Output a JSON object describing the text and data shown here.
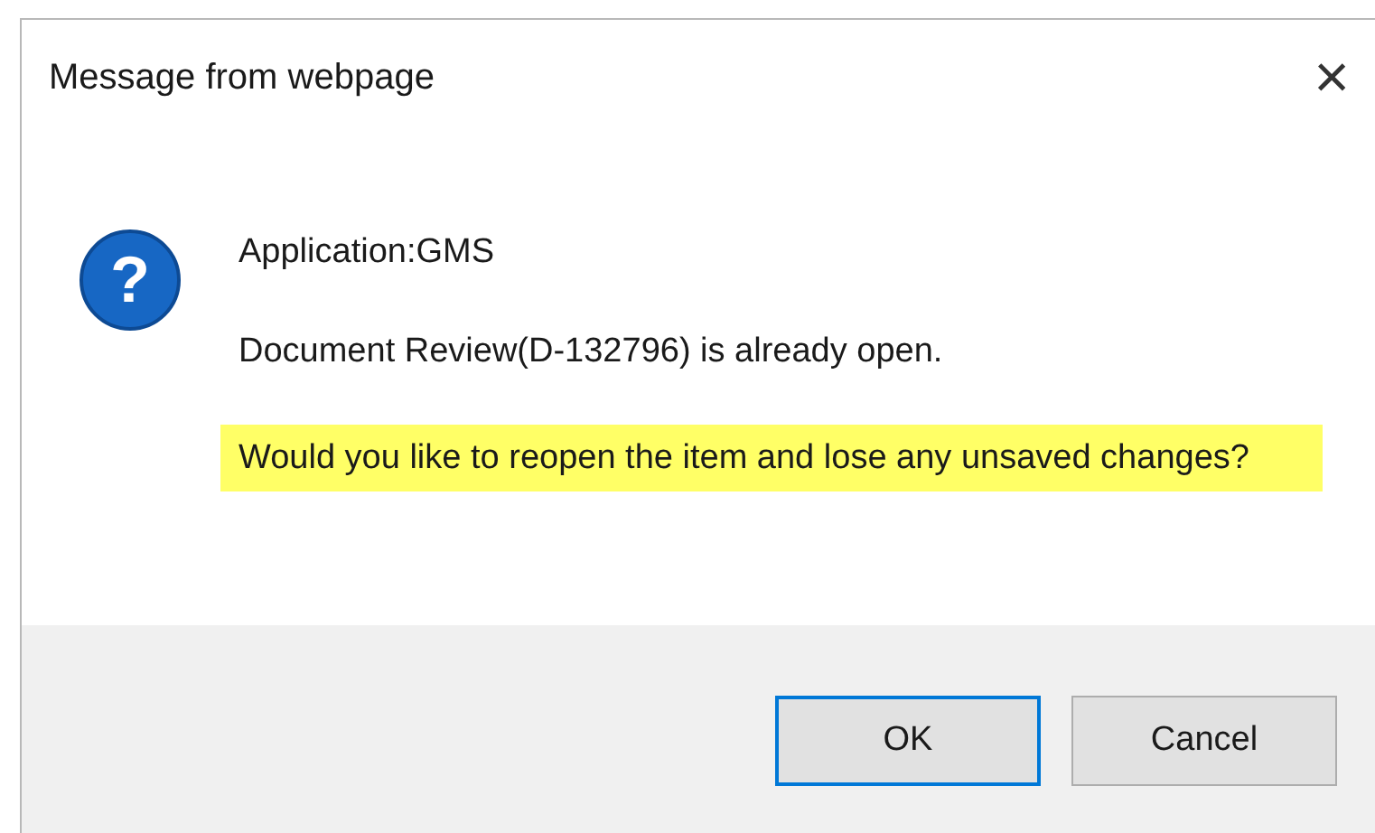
{
  "window": {
    "title": "Message from webpage",
    "close": "×"
  },
  "icon_glyph": "?",
  "messages": [
    {
      "text": "Application:GMS",
      "highlighted": false
    },
    {
      "text": "Document Review(D-132796) is already open.",
      "highlighted": false
    },
    {
      "text": "Would you like to reopen the item and lose any unsaved changes?",
      "highlighted": true
    }
  ],
  "buttons": [
    {
      "label": "OK",
      "selected": true
    },
    {
      "label": "Cancel",
      "selected": false
    }
  ]
}
